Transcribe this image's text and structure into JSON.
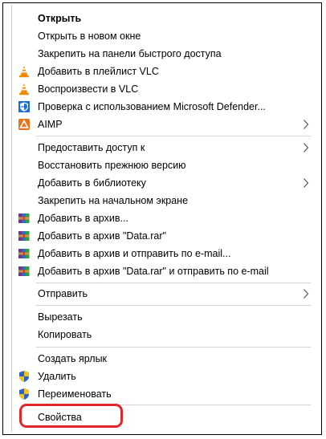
{
  "menu": {
    "items": {
      "open": "Открыть",
      "open_new_window": "Открыть в новом окне",
      "pin_quick_access": "Закрепить на панели быстрого доступа",
      "vlc_add_playlist": "Добавить в плейлист VLC",
      "vlc_play": "Воспроизвести в VLC",
      "defender_scan": "Проверка с использованием Microsoft Defender...",
      "aimp": "AIMP",
      "give_access": "Предоставить доступ к",
      "restore_previous": "Восстановить прежнюю версию",
      "add_to_library": "Добавить в библиотеку",
      "pin_start": "Закрепить на начальном экране",
      "add_archive": "Добавить в архив...",
      "add_archive_named": "Добавить в архив \"Data.rar\"",
      "archive_email": "Добавить в архив и отправить по e-mail...",
      "archive_named_email": "Добавить в архив \"Data.rar\" и отправить по e-mail",
      "send_to": "Отправить",
      "cut": "Вырезать",
      "copy": "Копировать",
      "create_shortcut": "Создать ярлык",
      "delete": "Удалить",
      "rename": "Переименовать",
      "properties": "Свойства"
    }
  },
  "colors": {
    "highlight_border": "#e3262b",
    "vlc_orange": "#f28a00",
    "defender_blue": "#1f6fd0",
    "aimp_orange": "#e8731a",
    "shield_blue": "#2a62c9",
    "shield_yellow": "#f2c21b"
  },
  "icons": {
    "vlc": "vlc-cone-icon",
    "defender": "defender-shield-icon",
    "aimp": "aimp-icon",
    "winrar": "winrar-books-icon",
    "uac": "uac-shield-icon",
    "submenu": "chevron-right-icon"
  }
}
